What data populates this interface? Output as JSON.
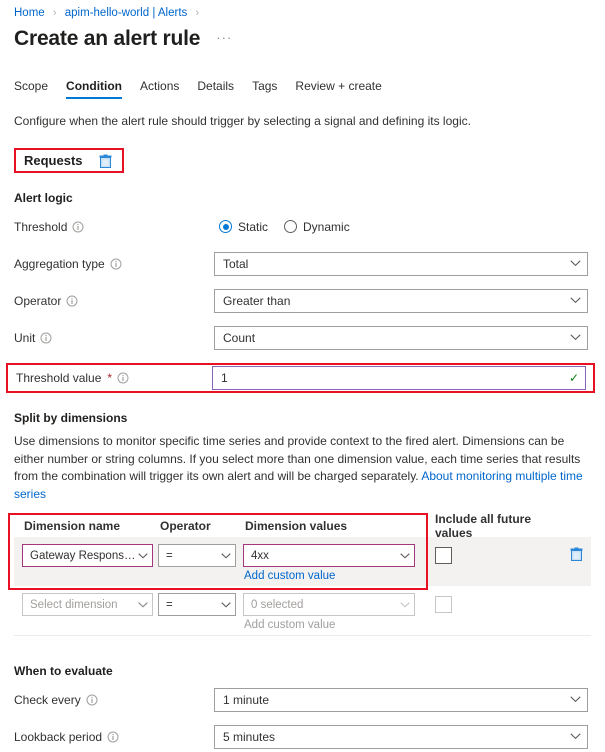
{
  "breadcrumb": {
    "items": [
      {
        "label": "Home"
      },
      {
        "label": "apim-hello-world | Alerts"
      }
    ],
    "separator": "›"
  },
  "header": {
    "title": "Create an alert rule",
    "more_menu": "···"
  },
  "tabs": [
    {
      "label": "Scope",
      "active": false
    },
    {
      "label": "Condition",
      "active": true
    },
    {
      "label": "Actions",
      "active": false
    },
    {
      "label": "Details",
      "active": false
    },
    {
      "label": "Tags",
      "active": false
    },
    {
      "label": "Review + create",
      "active": false
    }
  ],
  "intro": "Configure when the alert rule should trigger by selecting a signal and defining its logic.",
  "signal": {
    "name": "Requests",
    "delete_icon": "trash-icon"
  },
  "alert_logic": {
    "heading": "Alert logic",
    "threshold": {
      "label": "Threshold",
      "options": [
        {
          "label": "Static",
          "selected": true
        },
        {
          "label": "Dynamic",
          "selected": false
        }
      ]
    },
    "aggregation_type": {
      "label": "Aggregation type",
      "value": "Total"
    },
    "operator": {
      "label": "Operator",
      "value": "Greater than"
    },
    "unit": {
      "label": "Unit",
      "value": "Count"
    },
    "threshold_value": {
      "label": "Threshold value",
      "required_marker": "*",
      "value": "1",
      "valid_icon": "✓"
    }
  },
  "split_by_dimensions": {
    "heading": "Split by dimensions",
    "description_part1": "Use dimensions to monitor specific time series and provide context to the fired alert. Dimensions can be either number or string columns. If you select more than one dimension value, each time series that results from the combination will trigger its own alert and will be charged separately. ",
    "link_text": "About monitoring multiple time series",
    "columns": [
      "Dimension name",
      "Operator",
      "Dimension values",
      "Include all future values"
    ],
    "rows": [
      {
        "dimension_name": "Gateway Response C...",
        "operator": "=",
        "dimension_values": "4xx",
        "add_custom_value": "Add custom value",
        "include_future": false,
        "delete_icon": "trash-icon",
        "disabled": false
      },
      {
        "dimension_name": "Select dimension",
        "operator": "=",
        "dimension_values": "0 selected",
        "add_custom_value": "Add custom value",
        "include_future": false,
        "delete_icon": "",
        "disabled": true
      }
    ]
  },
  "when_to_evaluate": {
    "heading": "When to evaluate",
    "check_every": {
      "label": "Check every",
      "value": "1 minute"
    },
    "lookback_period": {
      "label": "Lookback period",
      "value": "5 minutes"
    }
  },
  "colors": {
    "accent": "#0078d4",
    "link": "#0066cc",
    "annotation": "#e81123",
    "focus_purple": "#8764b8",
    "valid_green": "#107c10",
    "required_red": "#a4262c"
  }
}
